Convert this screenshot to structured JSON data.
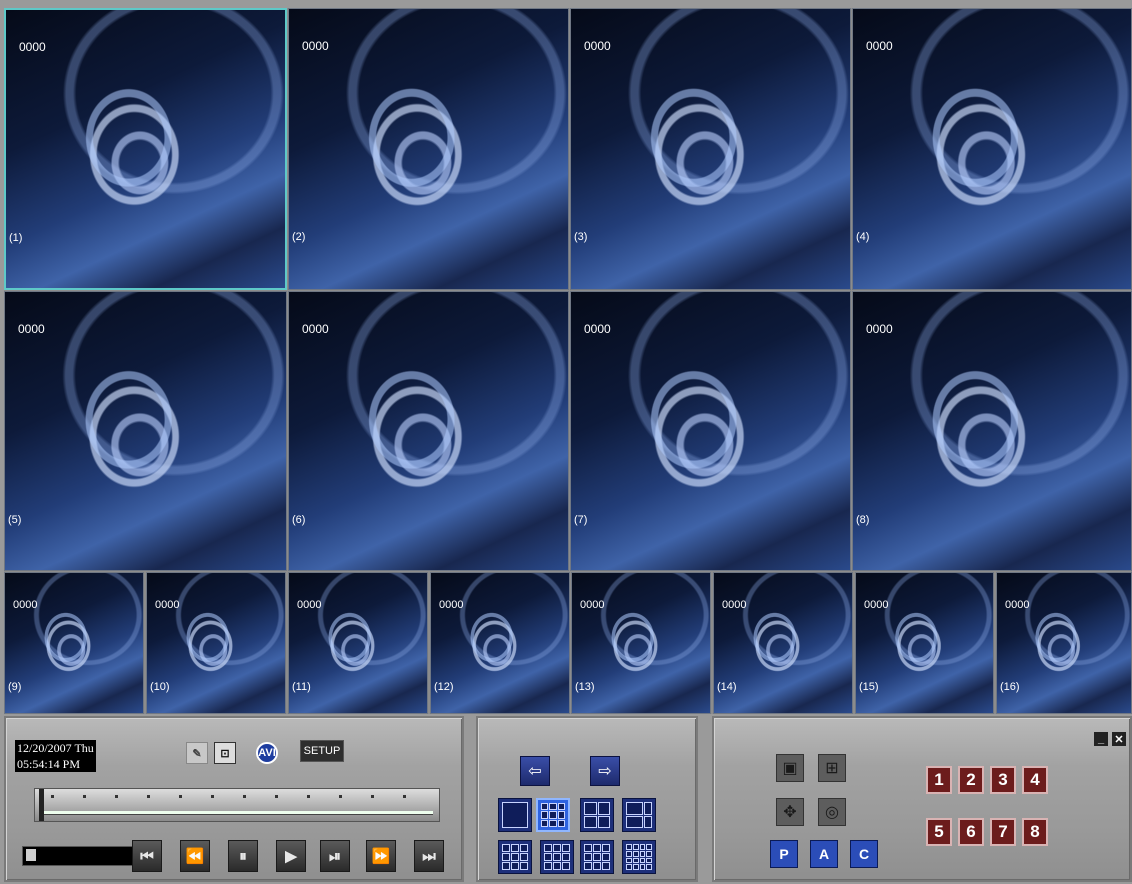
{
  "cameras": {
    "large": [
      {
        "code": "0000",
        "label": "(1)"
      },
      {
        "code": "0000",
        "label": "(2)"
      },
      {
        "code": "0000",
        "label": "(3)"
      },
      {
        "code": "0000",
        "label": "(4)"
      },
      {
        "code": "0000",
        "label": "(5)"
      },
      {
        "code": "0000",
        "label": "(6)"
      },
      {
        "code": "0000",
        "label": "(7)"
      },
      {
        "code": "0000",
        "label": "(8)"
      }
    ],
    "small": [
      {
        "code": "0000",
        "label": "(9)"
      },
      {
        "code": "0000",
        "label": "(10)"
      },
      {
        "code": "0000",
        "label": "(11)"
      },
      {
        "code": "0000",
        "label": "(12)"
      },
      {
        "code": "0000",
        "label": "(13)"
      },
      {
        "code": "0000",
        "label": "(14)"
      },
      {
        "code": "0000",
        "label": "(15)"
      },
      {
        "code": "0000",
        "label": "(16)"
      }
    ]
  },
  "status": {
    "date": "12/20/2007 Thu",
    "time": "05:54:14 PM"
  },
  "toolbar": {
    "avi_label": "AVI",
    "setup_label": "SETUP"
  },
  "playback_icons": [
    "skip-start-icon",
    "rewind-icon",
    "pause-icon",
    "play-icon",
    "step-forward-icon",
    "fast-forward-icon",
    "skip-end-icon"
  ],
  "playback_glyphs": [
    "⏮",
    "⏪",
    "⏸",
    "▶",
    "⏯",
    "⏩",
    "⏭"
  ],
  "layout_panel": {
    "prev_glyph": "⇦",
    "next_glyph": "⇨"
  },
  "ptz_panel": {
    "preset_labels": [
      "P",
      "A",
      "C"
    ]
  },
  "channels": [
    "1",
    "2",
    "3",
    "4",
    "5",
    "6",
    "7",
    "8"
  ],
  "window": {
    "minimize": "_",
    "close": "✕"
  }
}
